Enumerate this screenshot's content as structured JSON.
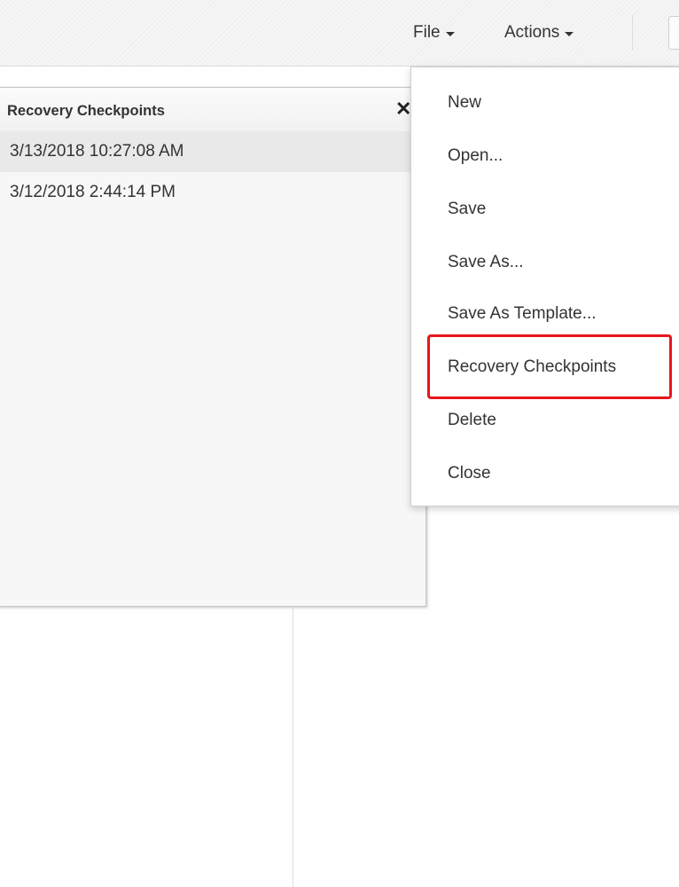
{
  "toolbar": {
    "file_label": "File",
    "actions_label": "Actions"
  },
  "checkpoints_panel": {
    "title": "Recovery Checkpoints",
    "close_glyph": "✕",
    "checkpoints": [
      {
        "label": "3/13/2018 10:27:08 AM",
        "selected": true
      },
      {
        "label": "3/12/2018 2:44:14 PM",
        "selected": false
      }
    ]
  },
  "file_menu": {
    "items": [
      {
        "label": "New"
      },
      {
        "label": "Open..."
      },
      {
        "label": "Save"
      },
      {
        "label": "Save As..."
      },
      {
        "label": "Save As Template..."
      },
      {
        "label": "Recovery Checkpoints",
        "highlighted": true
      },
      {
        "label": "Delete"
      },
      {
        "label": "Close"
      }
    ]
  },
  "colors": {
    "highlight_border": "#e8161b",
    "selected_row": "#e9e9e9"
  },
  "icons": {
    "caret": "caret-down-icon",
    "close": "close-icon"
  }
}
